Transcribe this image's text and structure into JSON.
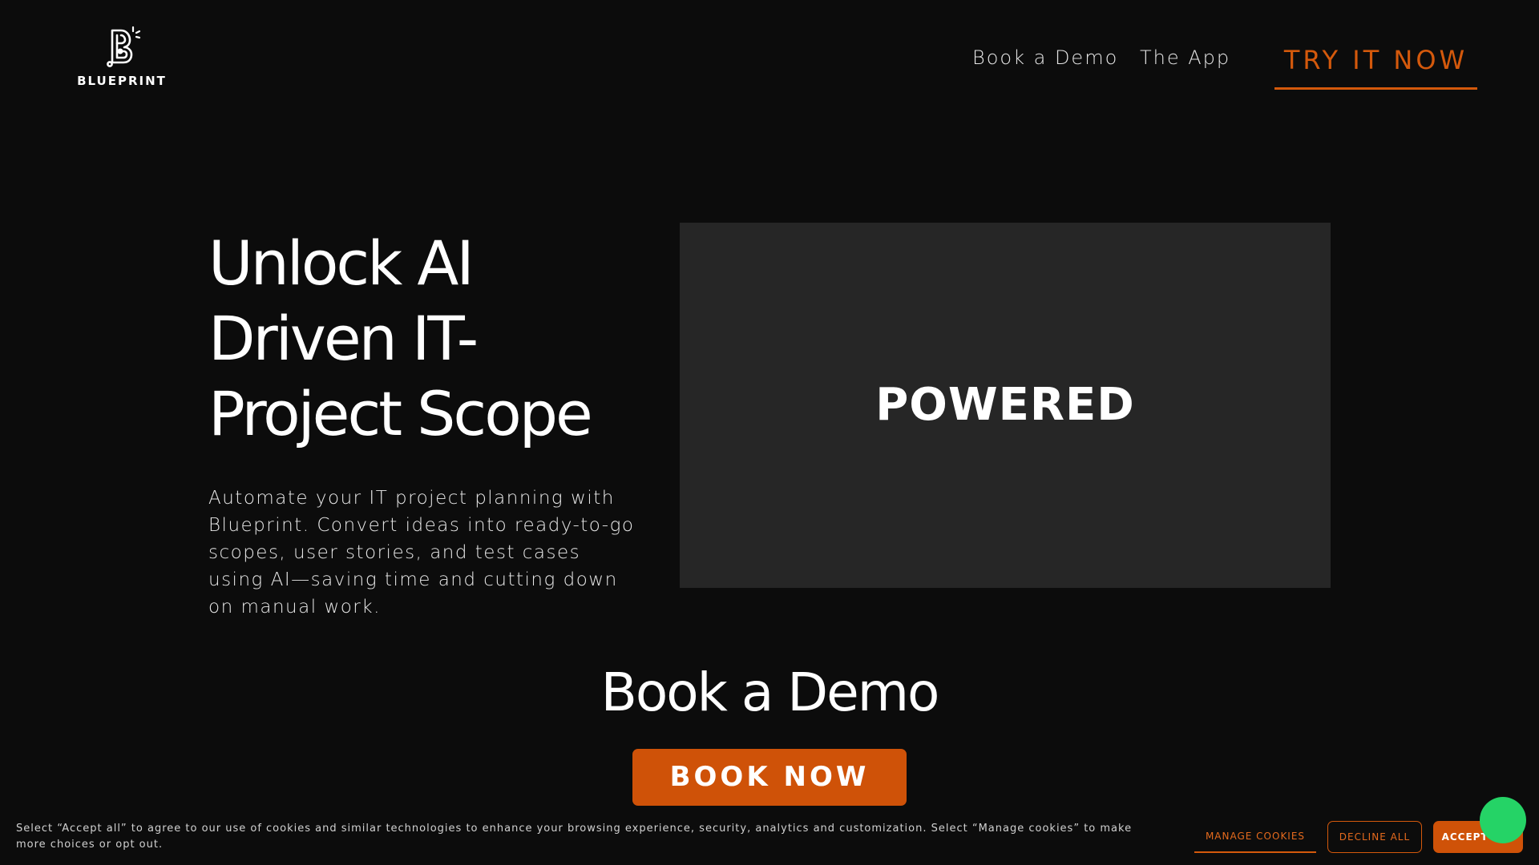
{
  "header": {
    "logo_text": "BLUEPRINT",
    "nav": [
      {
        "label": "Book a Demo"
      },
      {
        "label": "The App"
      }
    ],
    "cta_label": "TRY IT NOW"
  },
  "hero": {
    "title_lines": [
      "Unlock AI",
      "Driven IT-",
      "Project Scope"
    ],
    "description": "Automate your IT project planning with Blueprint. Convert ideas into ready-to-go scopes, user stories, and test cases using AI—saving time and cutting down on manual work.",
    "media_word": "POWERED"
  },
  "demo": {
    "title": "Book a Demo",
    "button_label": "BOOK NOW"
  },
  "cookie_banner": {
    "text": "Select “Accept all” to agree to our use of cookies and similar technologies to enhance your browsing experience, security, analytics and customization. Select “Manage cookies” to make more choices or opt out.",
    "manage_label": "MANAGE COOKIES",
    "decline_label": "DECLINE ALL",
    "accept_label": "ACCEPT ALL"
  },
  "colors": {
    "background": "#0c0c0c",
    "accent": "#cf5208",
    "media_panel": "#262626",
    "chat": "#25d366"
  },
  "icons": {
    "logo": "blueprint-b-logo-icon",
    "chat": "chat-bubble-icon"
  }
}
